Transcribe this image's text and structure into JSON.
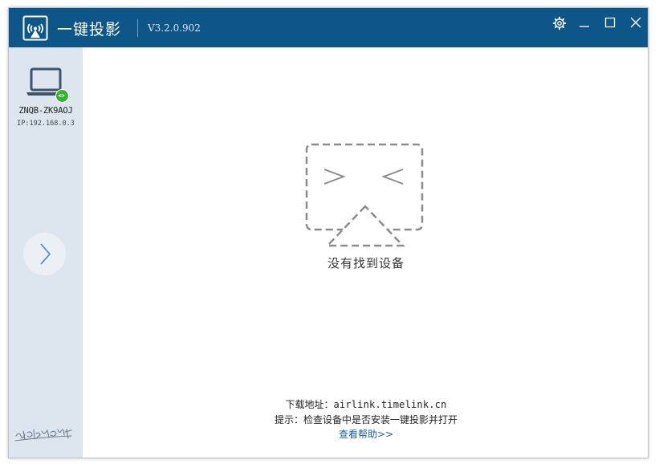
{
  "app": {
    "title": "一键投影",
    "version": "V3.2.0.902"
  },
  "titlebar": {
    "icons": [
      "settings-gear-icon",
      "minimize-icon",
      "maximize-icon",
      "close-icon"
    ]
  },
  "device": {
    "name": "ZNQB-ZK9AOJ",
    "ip": "IP:192.168.0.3",
    "status_icon": "eye-icon",
    "status_color": "#38b12e"
  },
  "sidebar": {
    "next_icon": "chevron-right-icon"
  },
  "main": {
    "empty_text": "没有找到设备"
  },
  "footer": {
    "download_label": "下载地址：",
    "download_url": "airlink.timelink.cn",
    "tip": "提示：检查设备中是否安装一键投影并打开",
    "help_link": "查看帮助>>"
  },
  "colors": {
    "titlebar": "#0d5687",
    "sidebar": "#dde6ee",
    "link": "#1a5f9e"
  }
}
